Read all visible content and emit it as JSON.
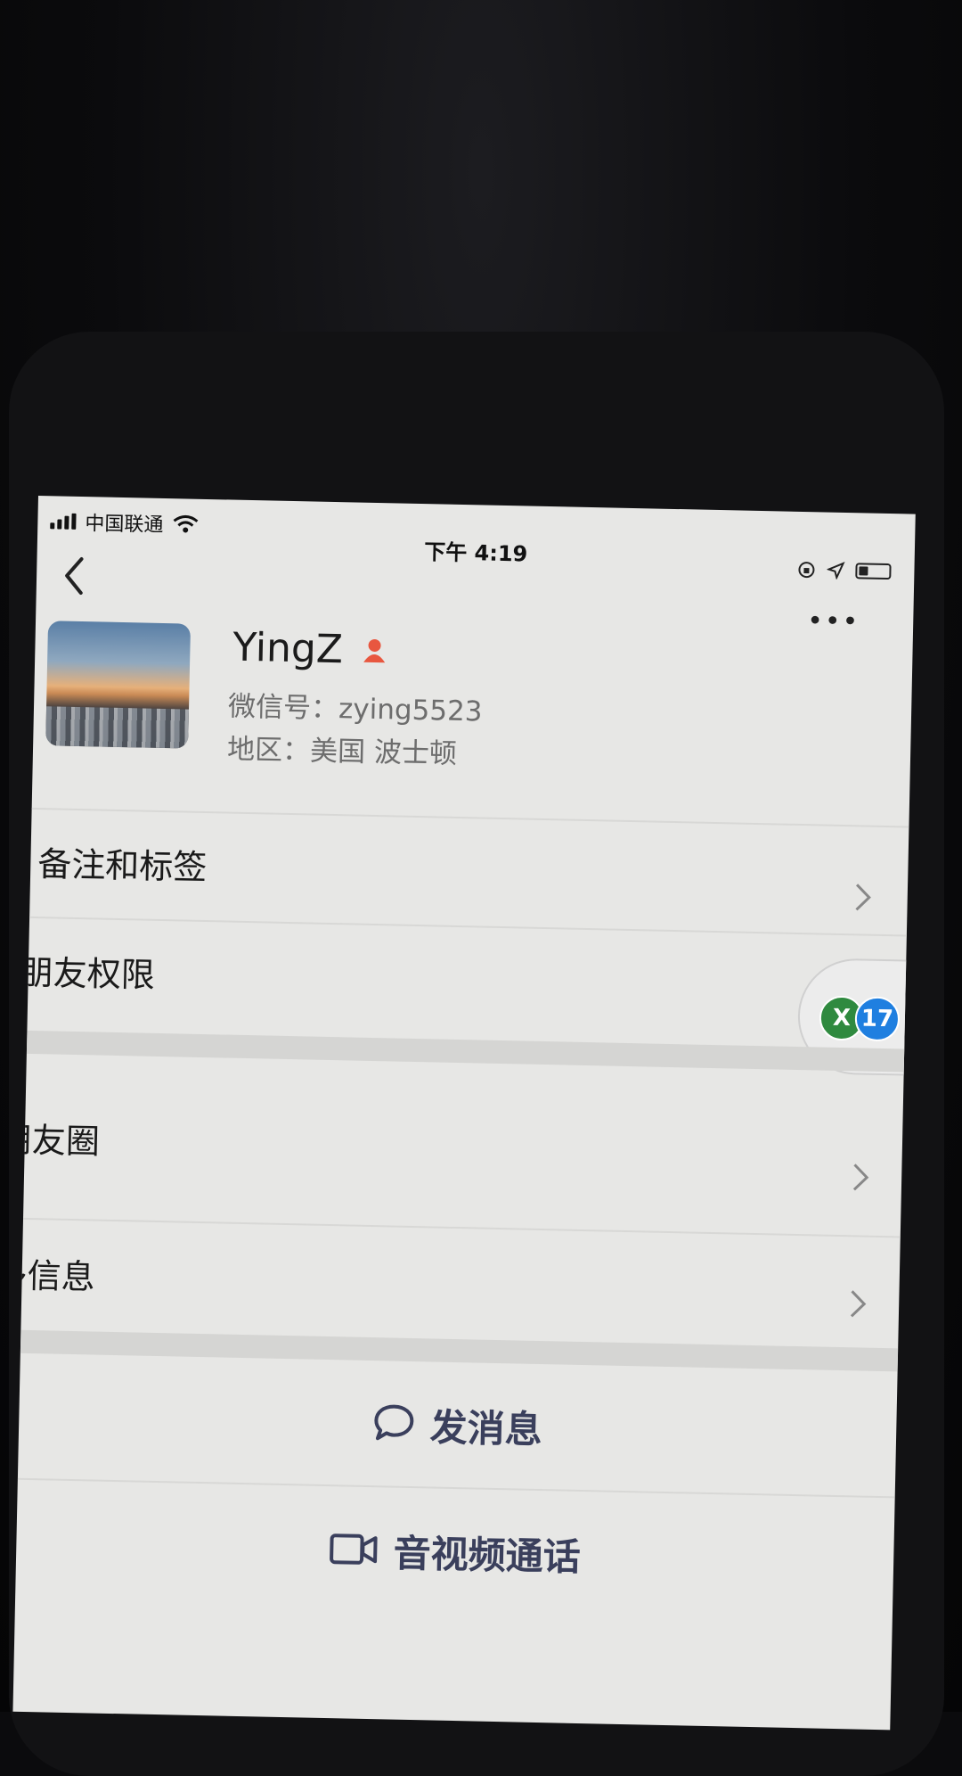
{
  "status_bar": {
    "carrier": "中国联通",
    "time": "下午 4:19",
    "battery_level": 0.3
  },
  "profile": {
    "name": "YingZ",
    "wechat_id": "微信号：zying5523",
    "region": "地区：美国 波士顿",
    "gender_icon": "female-icon",
    "gender_color": "#e8573f"
  },
  "rows": {
    "remarks_tags": "备注和标签",
    "friend_permissions": "朋友权限",
    "moments": "朋友圈",
    "more_info": "更多信息"
  },
  "actions": {
    "send_message": "发消息",
    "video_call": "音视频通话"
  },
  "floating": {
    "left_badge": "X",
    "right_badge": "17"
  },
  "colors": {
    "screen_bg": "#e7e7e5",
    "action_text": "#3a3f5c"
  }
}
